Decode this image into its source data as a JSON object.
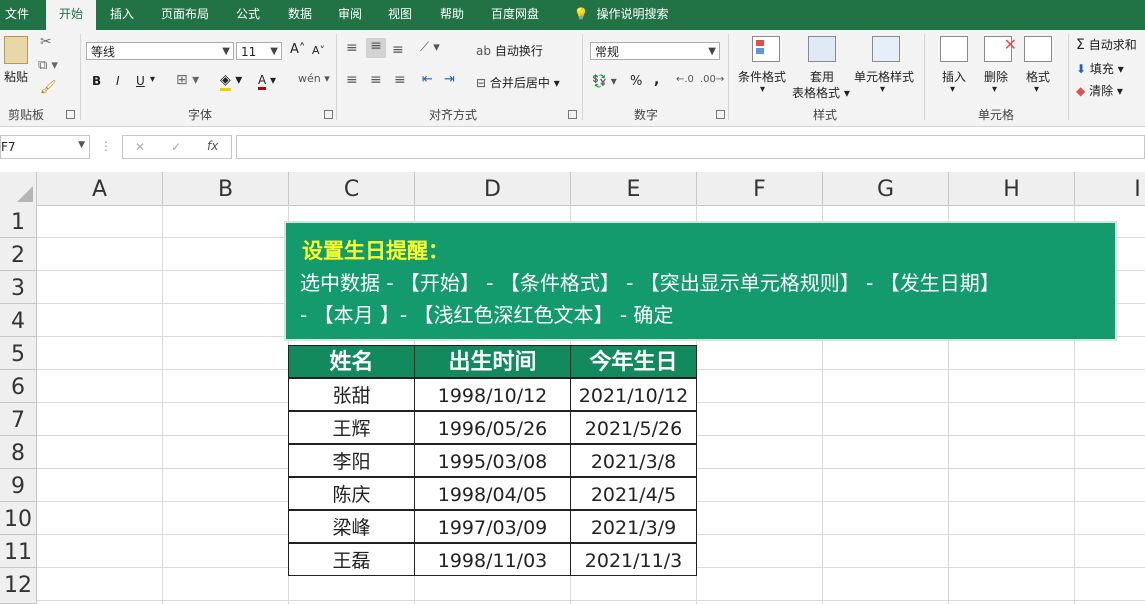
{
  "menu": {
    "items": [
      "文件",
      "开始",
      "插入",
      "页面布局",
      "公式",
      "数据",
      "审阅",
      "视图",
      "帮助",
      "百度网盘"
    ],
    "active": "开始",
    "search_label": "操作说明搜索"
  },
  "ribbon": {
    "clipboard": {
      "paste": "粘贴",
      "group": "剪贴板"
    },
    "font": {
      "name": "等线",
      "size": "11",
      "group": "字体",
      "bold": "B",
      "italic": "I",
      "underline": "U",
      "grow": "A",
      "shrink": "A",
      "font_color": "A"
    },
    "alignment": {
      "wrap": "自动换行",
      "merge": "合并后居中",
      "group": "对齐方式"
    },
    "number": {
      "format": "常规",
      "group": "数字",
      "percent": "%",
      "comma": ","
    },
    "styles": {
      "conditional": "条件格式",
      "table_line1": "套用",
      "table_line2": "表格格式",
      "cell_styles": "单元格样式",
      "group": "样式"
    },
    "cells": {
      "insert": "插入",
      "delete": "删除",
      "format": "格式",
      "group": "单元格"
    },
    "editing": {
      "autosum": "自动求和",
      "fill": "填充",
      "clear": "清除"
    }
  },
  "formula_bar": {
    "name_box": "F7",
    "cancel": "✕",
    "enter": "✓",
    "fx": "fx",
    "content": ""
  },
  "columns": [
    "A",
    "B",
    "C",
    "D",
    "E",
    "F",
    "G",
    "H",
    "I"
  ],
  "rows": [
    "1",
    "2",
    "3",
    "4",
    "5",
    "6",
    "7",
    "8",
    "9",
    "10",
    "11",
    "12"
  ],
  "callout": {
    "title": "设置生日提醒：",
    "line1": "选中数据 - 【开始】 - 【条件格式】 - 【突出显示单元格规则】 - 【发生日期】",
    "line2": "- 【本月 】- 【浅红色深红色文本】 - 确定"
  },
  "table": {
    "headers": [
      "姓名",
      "出生时间",
      "今年生日"
    ],
    "rows": [
      [
        "张甜",
        "1998/10/12",
        "2021/10/12"
      ],
      [
        "王辉",
        "1996/05/26",
        "2021/5/26"
      ],
      [
        "李阳",
        "1995/03/08",
        "2021/3/8"
      ],
      [
        "陈庆",
        "1998/04/05",
        "2021/4/5"
      ],
      [
        "梁峰",
        "1997/03/09",
        "2021/3/9"
      ],
      [
        "王磊",
        "1998/11/03",
        "2021/11/3"
      ]
    ]
  },
  "colors": {
    "excel_green": "#217346",
    "header_fill": "#138a5e",
    "callout_fill": "#139b6d",
    "callout_title": "#ffff2e"
  }
}
